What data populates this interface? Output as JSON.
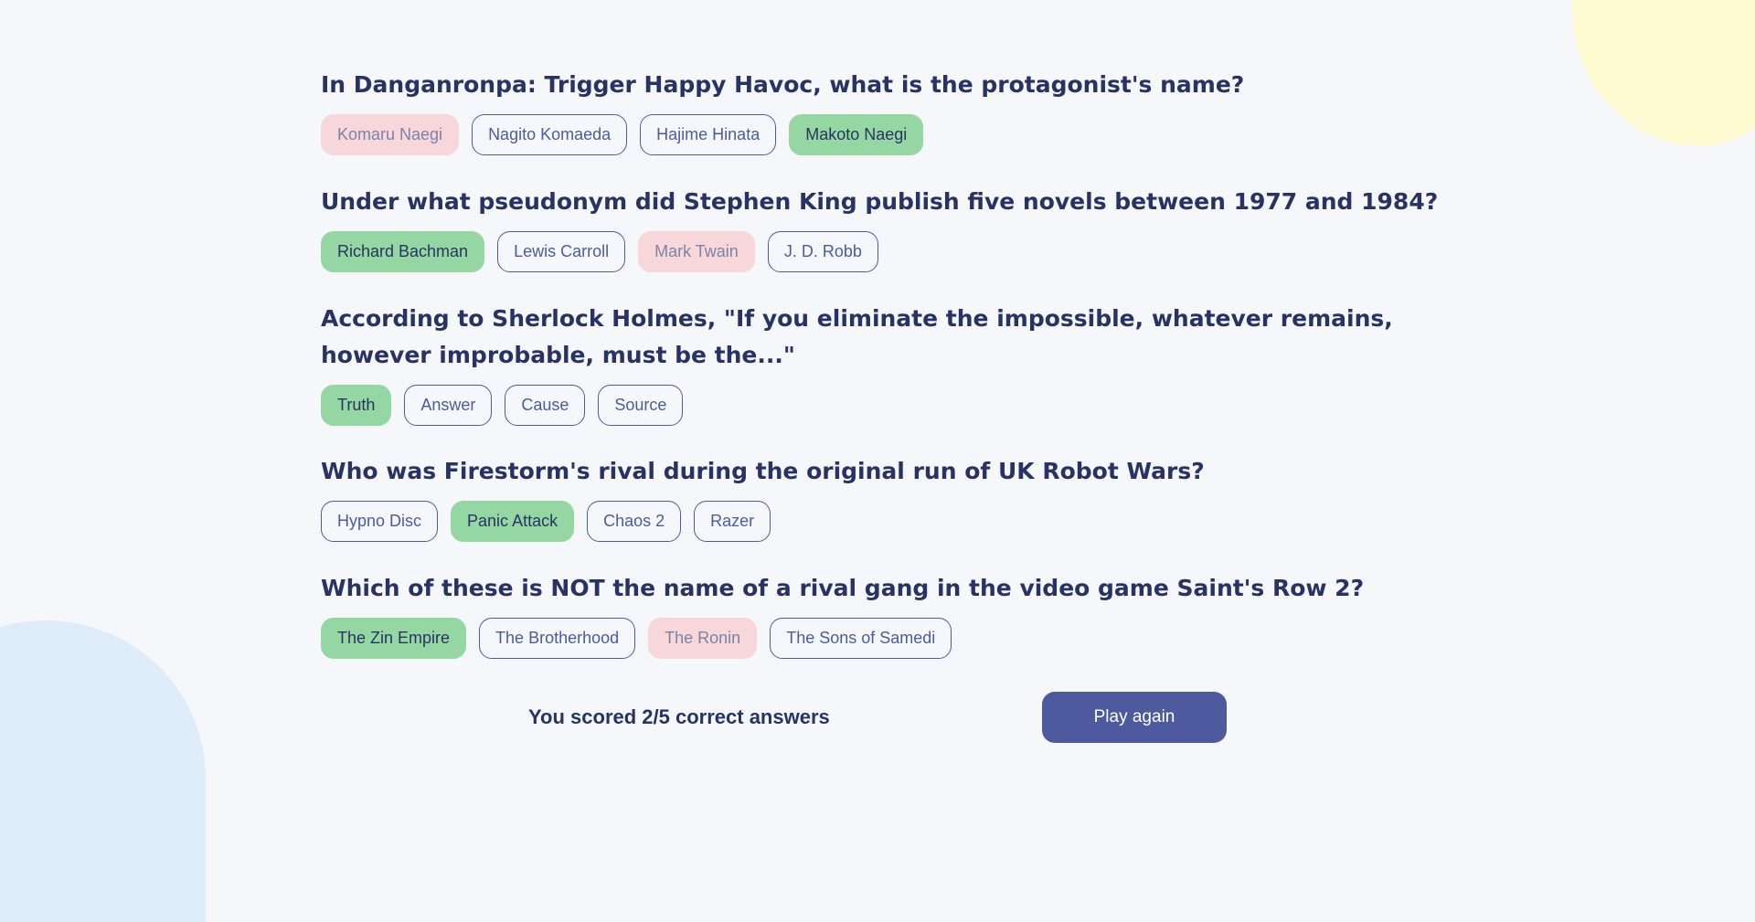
{
  "colors": {
    "background": "#F5F7FB",
    "text": "#293264",
    "accent": "#4D5B9E",
    "correct": "#94D7A2",
    "wrong": "#F8D7DA",
    "blob_yellow": "#FFFAD1",
    "blob_blue": "#DEEBF8"
  },
  "questions": [
    {
      "text": "In Danganronpa: Trigger Happy Havoc, what is the protagonist's name?",
      "answers": [
        {
          "label": "Komaru Naegi",
          "state": "wrong"
        },
        {
          "label": "Nagito Komaeda",
          "state": "neutral"
        },
        {
          "label": "Hajime Hinata",
          "state": "neutral"
        },
        {
          "label": "Makoto Naegi",
          "state": "correct"
        }
      ]
    },
    {
      "text": "Under what pseudonym did Stephen King publish five novels between 1977 and 1984?",
      "answers": [
        {
          "label": "Richard Bachman",
          "state": "correct"
        },
        {
          "label": "Lewis Carroll",
          "state": "neutral"
        },
        {
          "label": "Mark Twain",
          "state": "wrong"
        },
        {
          "label": "J. D. Robb",
          "state": "neutral"
        }
      ]
    },
    {
      "text": "According to Sherlock Holmes, \"If you eliminate the impossible, whatever remains, however improbable, must be the...\"",
      "answers": [
        {
          "label": "Truth",
          "state": "correct"
        },
        {
          "label": "Answer",
          "state": "neutral"
        },
        {
          "label": "Cause",
          "state": "neutral"
        },
        {
          "label": "Source",
          "state": "neutral"
        }
      ]
    },
    {
      "text": "Who was Firestorm's rival during the original run of UK Robot Wars?",
      "answers": [
        {
          "label": "Hypno Disc",
          "state": "neutral"
        },
        {
          "label": "Panic Attack",
          "state": "correct"
        },
        {
          "label": "Chaos 2",
          "state": "neutral"
        },
        {
          "label": "Razer",
          "state": "neutral"
        }
      ]
    },
    {
      "text": "Which of these is NOT the name of a rival gang in the video game Saint's Row 2?",
      "answers": [
        {
          "label": "The Zin Empire",
          "state": "correct"
        },
        {
          "label": "The Brotherhood",
          "state": "neutral"
        },
        {
          "label": "The Ronin",
          "state": "wrong"
        },
        {
          "label": "The Sons of Samedi",
          "state": "neutral"
        }
      ]
    }
  ],
  "footer": {
    "score_text": "You scored 2/5 correct answers",
    "play_again_label": "Play again"
  }
}
